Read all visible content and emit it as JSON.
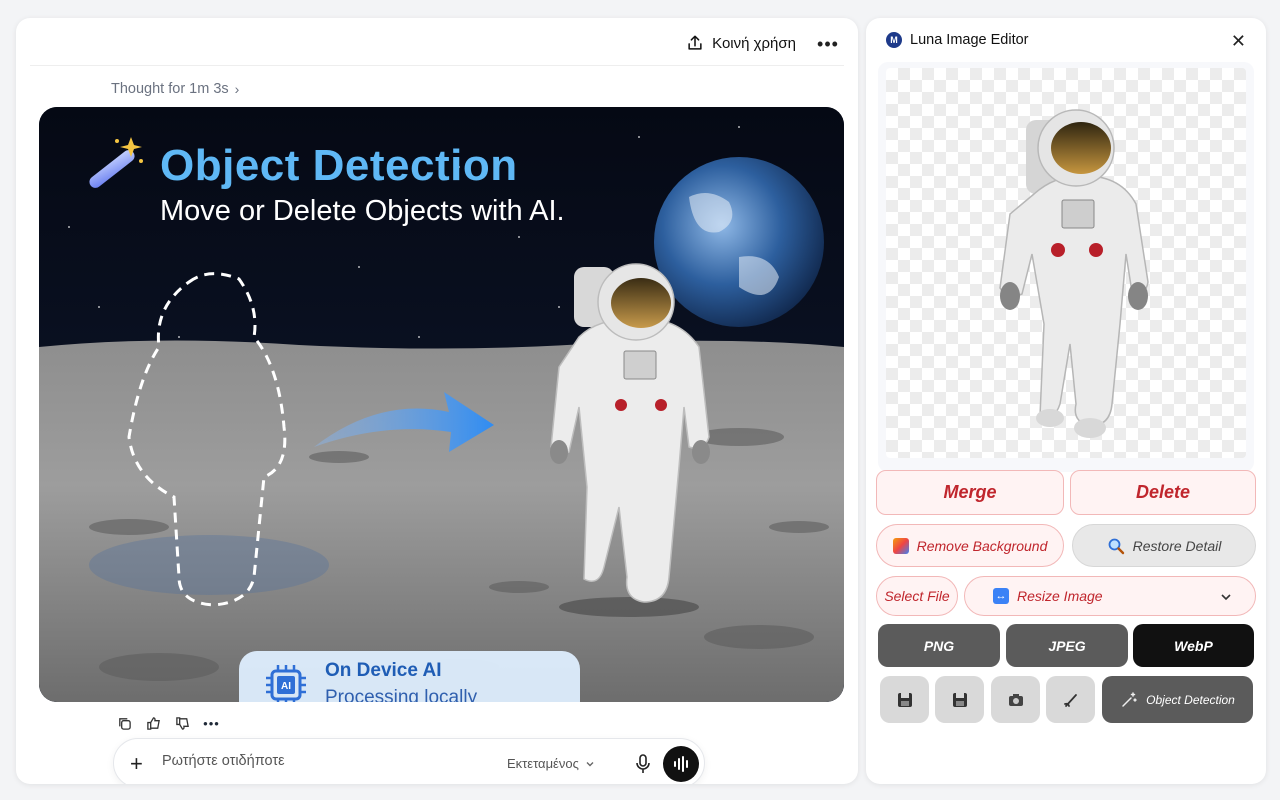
{
  "chat": {
    "share_label": "Κοινή χρήση",
    "thought_label": "Thought for 1m 3s",
    "hero": {
      "title": "Object Detection",
      "subtitle": "Move or Delete Objects with AI.",
      "badge_title": "On Device AI",
      "badge_subtitle": "Processing locally"
    },
    "composer": {
      "placeholder": "Ρωτήστε οτιδήποτε",
      "model_label": "Εκτεταμένος"
    }
  },
  "editor": {
    "title": "Luna Image Editor",
    "logo_letter": "M",
    "merge_label": "Merge",
    "delete_label": "Delete",
    "remove_bg_label": "Remove Background",
    "restore_detail_label": "Restore Detail",
    "select_file_label": "Select File",
    "resize_label": "Resize Image",
    "formats": [
      "PNG",
      "JPEG",
      "WebP"
    ],
    "selected_format": "WebP",
    "object_detection_label": "Object Detection"
  },
  "colors": {
    "accent_red": "#c0262d",
    "title_blue": "#5fb8f5",
    "badge_blue": "#1f5db5"
  }
}
